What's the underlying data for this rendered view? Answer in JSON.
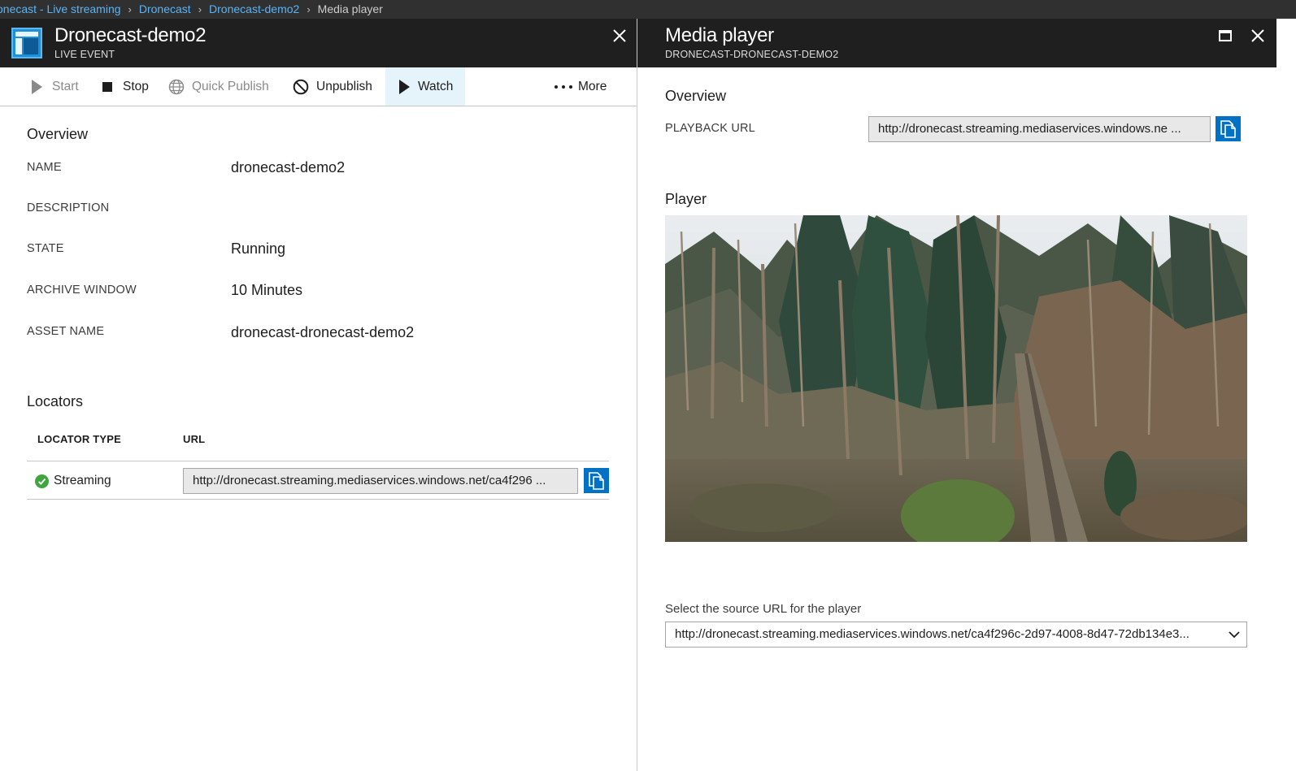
{
  "breadcrumb": {
    "items": [
      "onecast - Live streaming",
      "Dronecast",
      "Dronecast-demo2"
    ],
    "current": "Media player"
  },
  "left_blade": {
    "title": "Dronecast-demo2",
    "subtitle": "LIVE EVENT",
    "toolbar": {
      "start": "Start",
      "stop": "Stop",
      "quick_publish": "Quick Publish",
      "unpublish": "Unpublish",
      "watch": "Watch",
      "more": "More"
    },
    "overview": {
      "title": "Overview",
      "properties": [
        {
          "label": "NAME",
          "value": "dronecast-demo2"
        },
        {
          "label": "DESCRIPTION",
          "value": ""
        },
        {
          "label": "STATE",
          "value": "Running"
        },
        {
          "label": "ARCHIVE WINDOW",
          "value": "10 Minutes"
        },
        {
          "label": "ASSET NAME",
          "value": "dronecast-dronecast-demo2"
        }
      ]
    },
    "locators": {
      "title": "Locators",
      "columns": [
        "LOCATOR TYPE",
        "URL"
      ],
      "rows": [
        {
          "type": "Streaming",
          "url": "http://dronecast.streaming.mediaservices.windows.net/ca4f296 ..."
        }
      ]
    }
  },
  "right_blade": {
    "title": "Media player",
    "subtitle": "DRONECAST-DRONECAST-DEMO2",
    "overview": {
      "title": "Overview",
      "playback_label": "PLAYBACK URL",
      "playback_url": "http://dronecast.streaming.mediaservices.windows.ne ..."
    },
    "player": {
      "title": "Player"
    },
    "source": {
      "label": "Select the source URL for the player",
      "selected": "http://dronecast.streaming.mediaservices.windows.net/ca4f296c-2d97-4008-8d47-72db134e3..."
    }
  },
  "colors": {
    "header_bg": "#1f1f1f",
    "breadcrumb_bg": "#303030",
    "link": "#59b4f5",
    "accent": "#0072c6",
    "success": "#3fa63f",
    "watch_active_bg": "#e5f3fb"
  }
}
